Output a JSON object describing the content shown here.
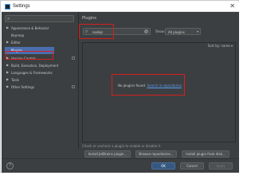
{
  "window": {
    "title": "Settings",
    "close_glyph": "✕"
  },
  "sidebar": {
    "search_placeholder": "",
    "items": [
      {
        "label": "Appearance & Behavior",
        "expandable": true,
        "selected": false
      },
      {
        "label": "Keymap",
        "expandable": false,
        "selected": false
      },
      {
        "label": "Editor",
        "expandable": true,
        "selected": false
      },
      {
        "label": "Plugins",
        "expandable": false,
        "selected": true
      },
      {
        "label": "Version Control",
        "expandable": true,
        "selected": false
      },
      {
        "label": "Build, Execution, Deployment",
        "expandable": true,
        "selected": false
      },
      {
        "label": "Languages & Frameworks",
        "expandable": true,
        "selected": false
      },
      {
        "label": "Tools",
        "expandable": true,
        "selected": false
      },
      {
        "label": "Other Settings",
        "expandable": true,
        "selected": false
      }
    ]
  },
  "main": {
    "title": "Plugins",
    "search_value": "nodejs",
    "show_label": "Show:",
    "show_selected": "All plugins",
    "sort_label": "Sort by: name ▾",
    "empty_text": "No plugins found.",
    "empty_link": "Search in repositories",
    "hint": "Check or uncheck a plugin to enable or disable it.",
    "buttons": {
      "install_jetbrains": "Install JetBrains plugin...",
      "browse_repos": "Browse repositories...",
      "install_disk": "Install plugin from disk..."
    }
  },
  "footer": {
    "help": "?",
    "ok": "OK",
    "cancel": "Cancel",
    "apply": "Apply"
  },
  "colors": {
    "background": "#3c3f41",
    "selection": "#4b6eaf",
    "link": "#589df6",
    "highlight_box": "#d51f1f"
  }
}
